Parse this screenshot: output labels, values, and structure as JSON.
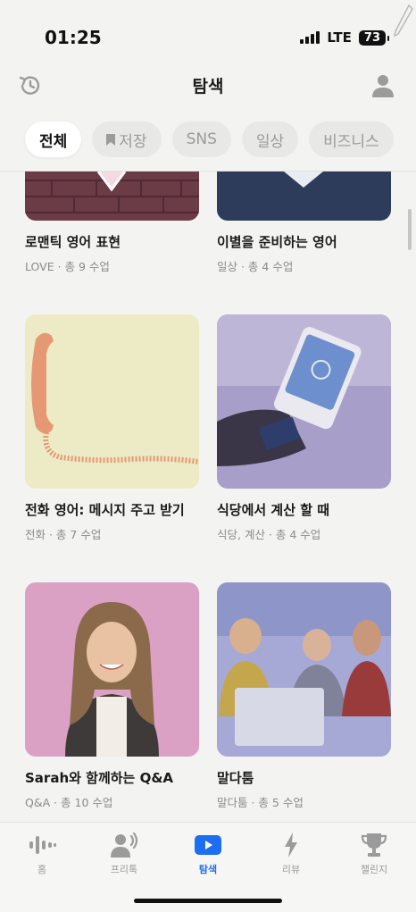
{
  "status_bar": {
    "time": "01:25",
    "network": "LTE",
    "battery": "73"
  },
  "header": {
    "title": "탐색",
    "left_icon": "history-icon",
    "right_icon": "profile-icon"
  },
  "tabs": [
    {
      "label": "전체",
      "active": true
    },
    {
      "label": "저장",
      "icon": "bookmark-icon"
    },
    {
      "label": "SNS"
    },
    {
      "label": "일상"
    },
    {
      "label": "비즈니스"
    }
  ],
  "cards": [
    {
      "title": "로맨틱 영어 표현",
      "meta": "LOVE · 총 9 수업"
    },
    {
      "title": "이별을 준비하는 영어",
      "meta": "일상 · 총 4 수업"
    },
    {
      "title": "전화 영어: 메시지 주고 받기",
      "meta": "전화 · 총 7 수업"
    },
    {
      "title": "식당에서 계산 할 때",
      "meta": "식당, 계산 · 총 4 수업"
    },
    {
      "title": "Sarah와 함께하는 Q&A",
      "meta": "Q&A · 총 10 수업"
    },
    {
      "title": "말다툼",
      "meta": "말다툼 · 총 5 수업"
    }
  ],
  "bottom_nav": [
    {
      "label": "홈",
      "icon": "waveform-icon"
    },
    {
      "label": "프리톡",
      "icon": "speaking-person-icon"
    },
    {
      "label": "탐색",
      "icon": "play-icon",
      "active": true
    },
    {
      "label": "리뷰",
      "icon": "lightning-icon"
    },
    {
      "label": "챌린지",
      "icon": "trophy-icon"
    }
  ],
  "colors": {
    "accent": "#1c6ef2",
    "background": "#f3f3f1"
  }
}
